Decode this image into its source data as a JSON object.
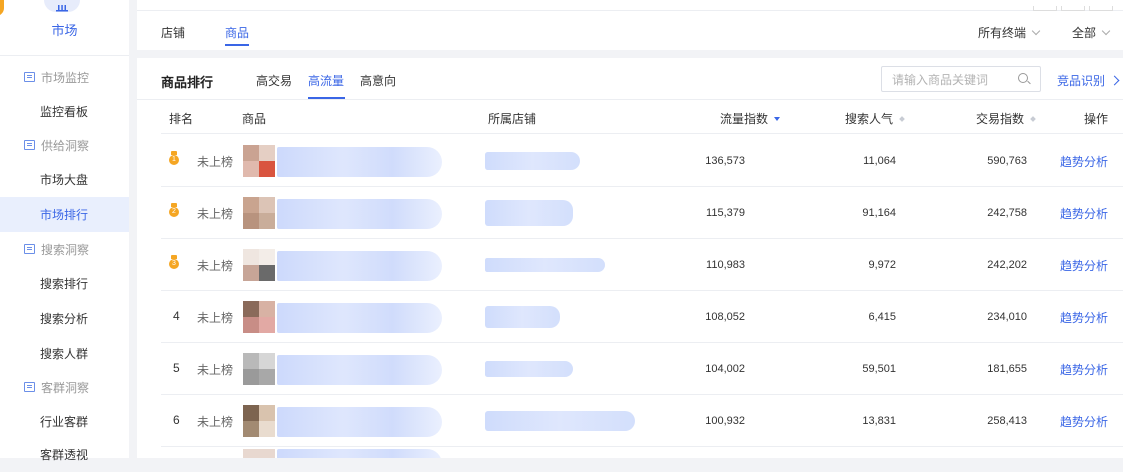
{
  "sidebar": {
    "market": "市场",
    "groups": [
      {
        "label": "市场监控",
        "items": [
          "监控看板"
        ]
      },
      {
        "label": "供给洞察",
        "items": [
          "市场大盘",
          "市场排行"
        ]
      },
      {
        "label": "搜索洞察",
        "items": [
          "搜索排行",
          "搜索分析",
          "搜索人群"
        ]
      },
      {
        "label": "客群洞察",
        "items": [
          "行业客群",
          "客群透视"
        ]
      }
    ],
    "active_item": "市场排行"
  },
  "topbar": {
    "tabs": [
      "店铺",
      "商品"
    ],
    "active_tab": "商品",
    "device_filter": "所有终端",
    "channel_filter": "全部"
  },
  "main": {
    "title": "商品排行",
    "subtabs": [
      "高交易",
      "高流量",
      "高意向"
    ],
    "active_subtab": "高流量",
    "search": {
      "placeholder": "请输入商品关键词"
    },
    "competitor_link": "竞品识别"
  },
  "table": {
    "headers": {
      "rank": "排名",
      "product": "商品",
      "shop": "所属店铺",
      "traffic": "流量指数",
      "search": "搜索人气",
      "trade": "交易指数",
      "action": "操作"
    },
    "sorted_column": "traffic",
    "rows": [
      {
        "rank": "1",
        "medal": true,
        "status": "未上榜",
        "traffic": "136,573",
        "search": "11,064",
        "trade": "590,763",
        "action": "趋势分析"
      },
      {
        "rank": "2",
        "medal": true,
        "status": "未上榜",
        "traffic": "115,379",
        "search": "91,164",
        "trade": "242,758",
        "action": "趋势分析"
      },
      {
        "rank": "3",
        "medal": true,
        "status": "未上榜",
        "traffic": "110,983",
        "search": "9,972",
        "trade": "242,202",
        "action": "趋势分析"
      },
      {
        "rank": "4",
        "medal": false,
        "status": "未上榜",
        "traffic": "108,052",
        "search": "6,415",
        "trade": "234,010",
        "action": "趋势分析"
      },
      {
        "rank": "5",
        "medal": false,
        "status": "未上榜",
        "traffic": "104,002",
        "search": "59,501",
        "trade": "181,655",
        "action": "趋势分析"
      },
      {
        "rank": "6",
        "medal": false,
        "status": "未上榜",
        "traffic": "100,932",
        "search": "13,831",
        "trade": "258,413",
        "action": "趋势分析"
      }
    ]
  },
  "colors": {
    "accent": "#3a66e6",
    "medal_gold": "#f5a623",
    "active_bg": "#e9effd"
  }
}
